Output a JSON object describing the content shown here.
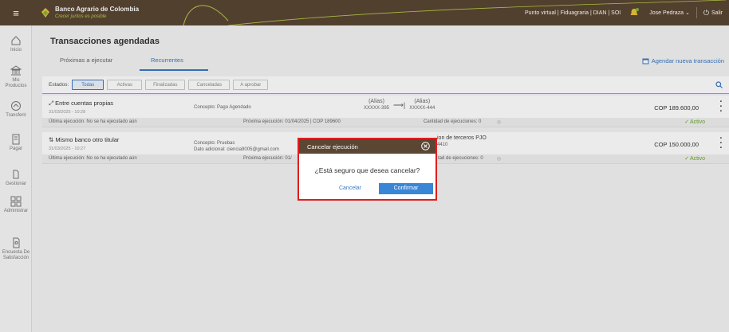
{
  "header": {
    "brand_name": "Banco Agrario de Colombia",
    "tagline": "Crecer juntos es posible",
    "links": "Punto virtual | Fiduagraria | DIAN | SOI",
    "user": "Jose Pedraza ⌄",
    "logout": "Salir",
    "menu_icon": "hamburger-icon",
    "bell_icon": "notification-icon",
    "colors": {
      "bar": "#5a4632",
      "tagline": "#b8c94a"
    }
  },
  "sidebar": {
    "items": [
      {
        "label": "Inicio",
        "icon": "home-icon"
      },
      {
        "label": "Mis\nProductos",
        "icon": "bank-icon"
      },
      {
        "label": "Transferir",
        "icon": "transfer-icon"
      },
      {
        "label": "Pagar",
        "icon": "pay-icon"
      },
      {
        "label": "Gestionar",
        "icon": "manage-icon"
      },
      {
        "label": "Administrar",
        "icon": "admin-icon"
      },
      {
        "label": "Encuesta De\nSatisfacción",
        "icon": "survey-icon"
      }
    ]
  },
  "page": {
    "title": "Transacciones agendadas",
    "tabs": [
      "Próximas a ejecutar",
      "Recurrentes"
    ],
    "active_tab": "Recurrentes",
    "schedule_link": "Agendar nueva transacción"
  },
  "filters": {
    "label": "Estados:",
    "chips": [
      "Todas",
      "Activas",
      "Finalizadas",
      "Canceladas",
      "A aprobar"
    ],
    "active": "Todas"
  },
  "transactions": [
    {
      "title": "Entre cuentas propias",
      "date": "31/03/2025 - 10:28",
      "concept": "Concepto: Pago Agendado",
      "from_alias": "(Alias)",
      "from_acct": "XXXXX-395",
      "to_alias": "(Alias)",
      "to_acct": "XXXXX-444",
      "amount": "COP 189.600,00",
      "last_exec": "Última ejecución:  No se ha ejecutado aún",
      "next_exec": "Próxima ejecución:  01/04/2025 | COP 189600",
      "count": "Cantidad de ejecuciones:  0",
      "status": "Activo"
    },
    {
      "title": "Mismo banco otro titular",
      "date": "31/03/2025 - 10:27",
      "concept": "Concepto: Pruebas",
      "extra": "Dato adicional: ciencia9005@gmail.com",
      "dest": "ion de terceros PJO",
      "dest_acct": "4410",
      "amount": "COP 150.000,00",
      "last_exec": "Última ejecución:  No se ha ejecutado aún",
      "next_exec": "Próxima ejecución:  01/",
      "count": "tad de ejecuciones:  0",
      "status": "Activo"
    }
  ],
  "dialog": {
    "title": "Cancelar ejecución",
    "message": "¿Está seguro que desea cancelar?",
    "cancel": "Cancelar",
    "confirm": "Confirmar",
    "colors": {
      "highlight": "#e01e1e",
      "confirm": "#3a86d6"
    }
  }
}
